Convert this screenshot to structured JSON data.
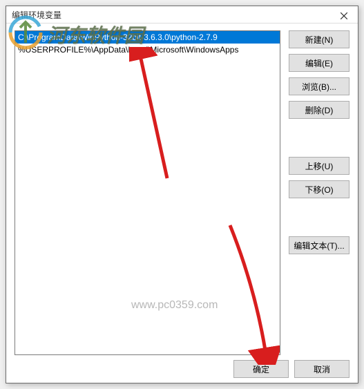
{
  "watermark": {
    "text": "河东软件园",
    "url": "www.pc0359.com"
  },
  "dialog": {
    "title": "编辑环境变量",
    "close_label": "×"
  },
  "list": {
    "items": [
      {
        "text": "C:\\ProgramData\\WinPython-32bit-3.6.3.0\\python-2.7.9",
        "selected": true
      },
      {
        "text": "%USERPROFILE%\\AppData\\Local\\Microsoft\\WindowsApps",
        "selected": false
      }
    ]
  },
  "buttons": {
    "new": "新建(N)",
    "edit": "编辑(E)",
    "browse": "浏览(B)...",
    "delete": "删除(D)",
    "moveup": "上移(U)",
    "movedown": "下移(O)",
    "edittext": "编辑文本(T)...",
    "ok": "确定",
    "cancel": "取消"
  }
}
